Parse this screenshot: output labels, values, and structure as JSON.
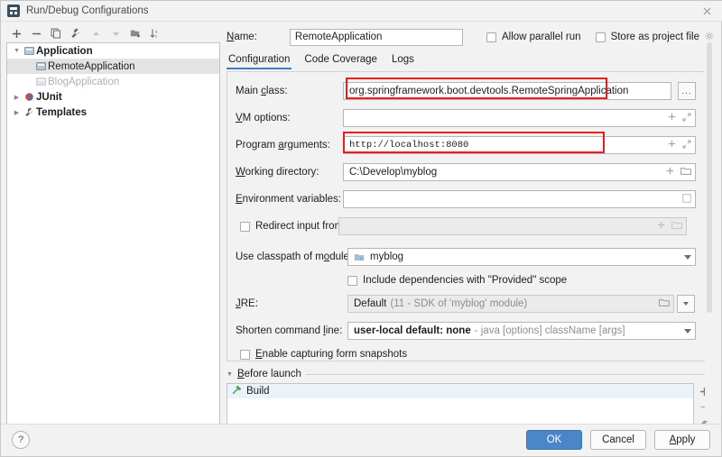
{
  "window": {
    "title": "Run/Debug Configurations",
    "app_icon": "intellij-idea-icon",
    "close_icon": "close-icon"
  },
  "left_panel": {
    "toolbar": [
      {
        "name": "add-configuration-button",
        "icon": "plus-icon",
        "label": "+"
      },
      {
        "name": "remove-configuration-button",
        "icon": "minus-icon",
        "label": "−"
      },
      {
        "name": "copy-configuration-button",
        "icon": "copy-icon",
        "label": "⧉"
      },
      {
        "name": "edit-templates-button",
        "icon": "wrench-icon",
        "label": "⚒"
      },
      {
        "name": "move-up-button",
        "icon": "arrow-up-icon",
        "label": "▲"
      },
      {
        "name": "move-down-button",
        "icon": "arrow-down-icon",
        "label": "▼"
      },
      {
        "name": "move-into-folder-button",
        "icon": "folder-add-icon",
        "label": "Ὄ1"
      },
      {
        "name": "sort-configurations-button",
        "icon": "sort-icon",
        "label": "↓"
      }
    ],
    "tree": [
      {
        "label": "Application",
        "level": 0,
        "expanded": true,
        "bold": true,
        "icon": "application-icon",
        "selected": false,
        "muted": false
      },
      {
        "label": "RemoteApplication",
        "level": 1,
        "expanded": null,
        "bold": false,
        "icon": "application-icon",
        "selected": true,
        "muted": false
      },
      {
        "label": "BlogApplication",
        "level": 1,
        "expanded": null,
        "bold": false,
        "icon": "application-icon",
        "selected": false,
        "muted": true
      },
      {
        "label": "JUnit",
        "level": 0,
        "expanded": false,
        "bold": true,
        "icon": "junit-icon",
        "selected": false,
        "muted": false
      },
      {
        "label": "Templates",
        "level": 0,
        "expanded": false,
        "bold": true,
        "icon": "wrench-icon",
        "selected": false,
        "muted": false
      }
    ]
  },
  "header": {
    "name_label": "Name:",
    "name_value": "RemoteApplication",
    "allow_parallel_run_label": "Allow parallel run",
    "allow_parallel_run_checked": false,
    "store_as_project_file_label": "Store as project file",
    "store_as_project_file_checked": false,
    "gear_icon": "gear-icon"
  },
  "tabs": [
    {
      "label": "Configuration",
      "active": true
    },
    {
      "label": "Code Coverage",
      "active": false
    },
    {
      "label": "Logs",
      "active": false
    }
  ],
  "form": {
    "main_class": {
      "label": "Main class:",
      "value": "org.springframework.boot.devtools.RemoteSpringApplication",
      "browse_label": "...",
      "highlighted": true
    },
    "vm_options": {
      "label": "VM options:",
      "value": "",
      "icons": [
        "plus-icon",
        "expand-icon"
      ]
    },
    "program_arguments": {
      "label": "Program arguments:",
      "value": "http://localhost:8080",
      "icons": [
        "plus-icon",
        "expand-icon"
      ],
      "highlighted": true
    },
    "working_directory": {
      "label": "Working directory:",
      "value": "C:\\Develop\\myblog",
      "icons": [
        "plus-icon",
        "folder-icon"
      ]
    },
    "environment_variables": {
      "label": "Environment variables:",
      "value": "",
      "icons": [
        "browse-icon"
      ]
    },
    "redirect_input": {
      "label": "Redirect input from:",
      "checked": false,
      "value": "",
      "icons": [
        "plus-icon",
        "folder-icon"
      ]
    },
    "classpath_module": {
      "label": "Use classpath of module:",
      "value": "myblog",
      "module_icon": "module-icon"
    },
    "include_provided": {
      "label": "Include dependencies with \"Provided\" scope",
      "checked": false
    },
    "jre": {
      "label": "JRE:",
      "value": "Default",
      "value_hint": "(11 - SDK of 'myblog' module)",
      "icons": [
        "folder-icon",
        "chevron-down-icon"
      ]
    },
    "shorten_command_line": {
      "label": "Shorten command line:",
      "value": "user-local default: none",
      "value_hint": "- java [options] className [args]"
    },
    "enable_form_snapshots": {
      "label": "Enable capturing form snapshots",
      "checked": false
    }
  },
  "before_launch": {
    "section_label": "Before launch",
    "collapsed": false,
    "items": [
      {
        "label": "Build",
        "icon": "build-hammer-icon",
        "selected": true
      }
    ],
    "side_buttons": [
      {
        "name": "add-task-button",
        "icon": "plus-icon",
        "label": "+"
      },
      {
        "name": "remove-task-button",
        "icon": "minus-icon",
        "label": "−"
      },
      {
        "name": "edit-task-button",
        "icon": "pencil-icon",
        "label": "✎"
      },
      {
        "name": "move-task-up-button",
        "icon": "arrow-up-icon",
        "label": "▲"
      }
    ]
  },
  "footer": {
    "help_label": "?",
    "ok_label": "OK",
    "cancel_label": "Cancel",
    "apply_label": "Apply"
  },
  "colors": {
    "accent": "#4a86c8",
    "highlight_box": "#ee1c1c",
    "tab_underline": "#3d7cc9",
    "selection": "#e3e3e3"
  }
}
